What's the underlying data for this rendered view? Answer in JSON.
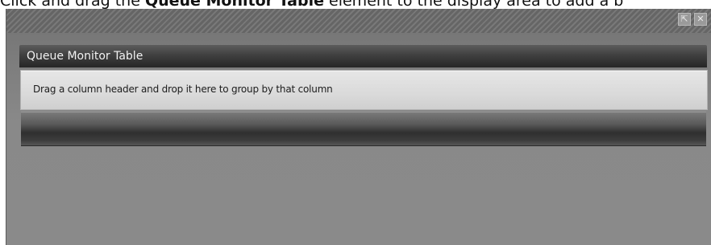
{
  "instruction": {
    "before": "Click and drag the ",
    "emphasis": "Queue Monitor Table",
    "after": " element to the display area to add a b"
  },
  "panel": {
    "popout_glyph": "⇱",
    "close_glyph": "✕"
  },
  "widget": {
    "title": "Queue Monitor Table",
    "group_prompt": "Drag a column header and drop it here to group by that column"
  },
  "icons": {
    "popout": "popout-icon",
    "close": "close-icon"
  }
}
